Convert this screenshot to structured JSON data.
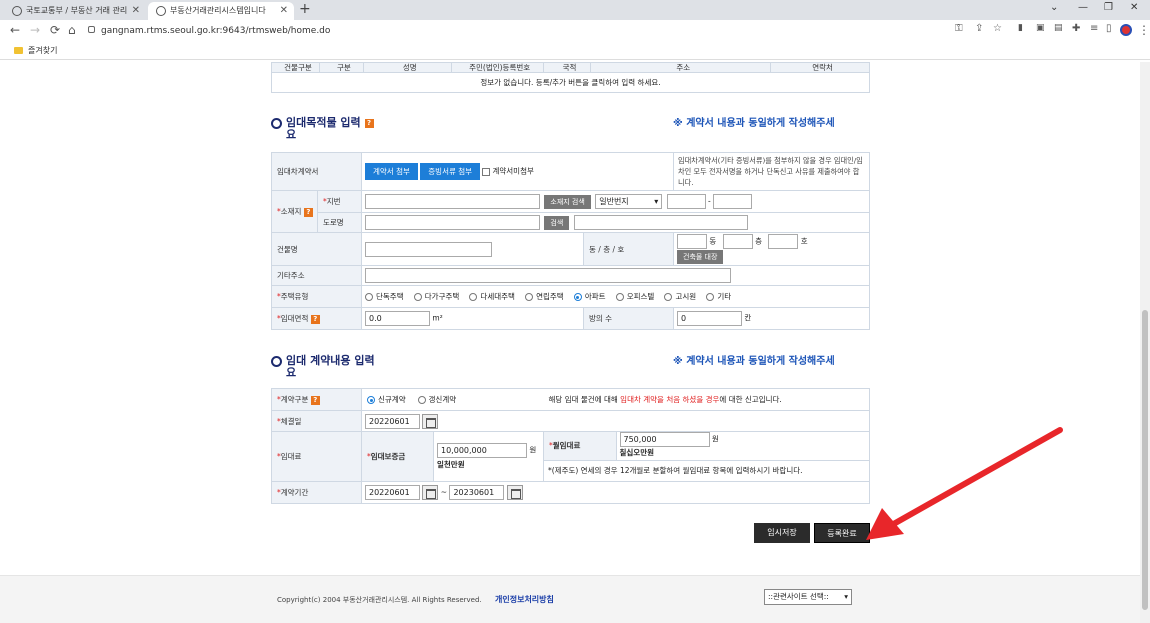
{
  "browser": {
    "tabs": [
      {
        "title": "국토교통부 / 부동산 거래 관리"
      },
      {
        "title": "부동산거래관리시스템입니다"
      }
    ],
    "url": "gangnam.rtms.seoul.go.kr:9643/rtmsweb/home.do",
    "bookmark": "즐겨찾기"
  },
  "prev_table": {
    "headers": [
      "건물구분",
      "구분",
      "성명",
      "주민(법인)등록번호",
      "국적",
      "주소",
      "연락처"
    ],
    "empty_msg": "정보가 없습니다.  등록/추가 버튼을 클릭하여 입력 하세요."
  },
  "section1": {
    "title_line1": "임대목적물 입력",
    "title_line2": "요",
    "note": "※ 계약서 내용과 동일하게 작성해주세",
    "contract_label": "임대차계약서",
    "attach_contract": "계약서 첨부",
    "attach_proof": "증빙서류 첨부",
    "no_contract": "계약서미첨부",
    "contract_help": "임대차계약서(기타 증빙서류)를 첨부하지 않을 경우 임대인/임차인 모두 전자서명을 하거나 단독신고 사유를 제출하여야 합니다.",
    "location_label": "소재지",
    "jibun_label": "지번",
    "addr_search": "소재지 검색",
    "lot_type": "일반번지",
    "dash": "-",
    "road_label": "도로명",
    "search": "검색",
    "building_label": "건물명",
    "dong_floor_ho_label": "동 / 층 / 호",
    "dong": "동",
    "floor": "층",
    "ho": "호",
    "ledger_btn": "건축물 대장",
    "other_addr_label": "기타주소",
    "house_type_label": "주택유형",
    "house_types": [
      "단독주택",
      "다가구주택",
      "다세대주택",
      "연립주택",
      "아파트",
      "오피스텔",
      "고시원",
      "기타"
    ],
    "house_type_selected": "아파트",
    "area_label": "임대면적",
    "area_value": "0.0",
    "area_unit": "m²",
    "rooms_label": "방의 수",
    "rooms_value": "0",
    "rooms_unit": "칸"
  },
  "section2": {
    "title_line1": "임대 계약내용 입력",
    "title_line2": "요",
    "note": "※ 계약서 내용과 동일하게 작성해주세",
    "contract_type_label": "계약구분",
    "new_contract": "신규계약",
    "renewal": "갱신계약",
    "type_help_pre": "해당 임대 물건에 대해 ",
    "type_help_red": "임대차 계약을 처음 하셨을 경우",
    "type_help_post": "에 대한 신고입니다.",
    "signed_label": "체결일",
    "signed_date": "20220601",
    "rent_label": "임대료",
    "deposit_label": "임대보증금",
    "deposit_value": "10,000,000",
    "won": "원",
    "deposit_korean": "일천만원",
    "monthly_label": "월임대료",
    "monthly_value": "750,000",
    "monthly_korean": "칠십오만원",
    "jeju_note": "*(제주도) 연세의 경우 12개월로 분할하여 월임대료 항목에 입력하시기 바랍니다.",
    "period_label": "계약기간",
    "period_start": "20220601",
    "tilde": "~",
    "period_end": "20230601"
  },
  "actions": {
    "temp_save": "임시저장",
    "register": "등록완료"
  },
  "footer": {
    "copyright": "Copyright(c) 2004 부동산거래관리시스템. All Rights Reserved.",
    "privacy": "개인정보처리방침",
    "related_sites": "::관련사이트 선택::"
  },
  "annotation": {
    "arrow_color": "#e8262a"
  }
}
